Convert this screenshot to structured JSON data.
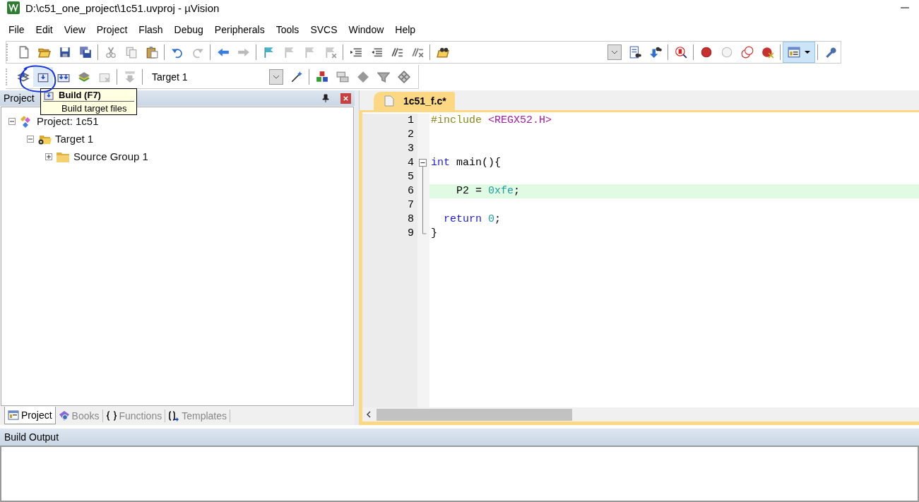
{
  "window": {
    "title": "D:\\c51_one_project\\1c51.uvproj - µVision"
  },
  "menu": [
    "File",
    "Edit",
    "View",
    "Project",
    "Flash",
    "Debug",
    "Peripherals",
    "Tools",
    "SVCS",
    "Window",
    "Help"
  ],
  "build_toolbar": {
    "target": "Target 1"
  },
  "tooltip": {
    "title": "Build (F7)",
    "description": "Build target files"
  },
  "project_panel": {
    "title": "Project",
    "tree": [
      {
        "label": "Project: 1c51",
        "kind": "project",
        "expanded": true,
        "children": [
          {
            "label": "Target 1",
            "kind": "target",
            "expanded": true,
            "children": [
              {
                "label": "Source Group 1",
                "kind": "group",
                "expanded": false
              }
            ]
          }
        ]
      }
    ],
    "tabs": [
      {
        "label": "Project",
        "kind": "project",
        "selected": true
      },
      {
        "label": "Books",
        "kind": "books",
        "selected": false
      },
      {
        "label": "Functions",
        "kind": "functions",
        "selected": false
      },
      {
        "label": "Templates",
        "kind": "templates",
        "selected": false
      }
    ]
  },
  "editor": {
    "tabs": [
      {
        "label": "1c51_f.c*",
        "selected": true
      }
    ],
    "lines": [
      {
        "number": "1",
        "tokens": [
          {
            "kind": "preprocessor",
            "text": "#include"
          },
          {
            "kind": "header",
            "text": " <REGX52.H>"
          }
        ]
      },
      {
        "number": "2"
      },
      {
        "number": "3"
      },
      {
        "number": "4",
        "expanded": true,
        "tokens": [
          {
            "kind": "keyword",
            "text": "int"
          },
          {
            "kind": "plain",
            "text": " main(){"
          }
        ]
      },
      {
        "number": "5"
      },
      {
        "number": "6",
        "highlighted": true,
        "tokens": [
          {
            "kind": "plain",
            "text": "    P2 = "
          },
          {
            "kind": "number",
            "text": "0xfe"
          },
          {
            "kind": "plain",
            "text": ";"
          }
        ]
      },
      {
        "number": "7"
      },
      {
        "number": "8",
        "tokens": [
          {
            "kind": "keyword",
            "text": "  return"
          },
          {
            "kind": "number",
            "text": " 0"
          },
          {
            "kind": "plain",
            "text": ";"
          }
        ]
      },
      {
        "number": "9",
        "tokens": [
          {
            "kind": "plain",
            "text": "}"
          }
        ]
      }
    ]
  },
  "build_output": {
    "title": "Build Output"
  }
}
